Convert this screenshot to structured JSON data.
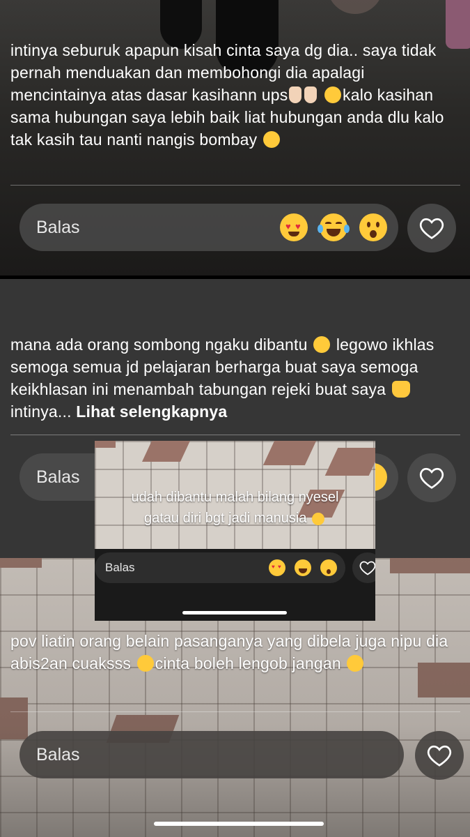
{
  "comments": [
    {
      "text_1": "intinya seburuk apapun kisah cinta saya dg dia.. saya tidak pernah menduakan dan membohongi dia apalagi mencintainya atas dasar kasihann ups",
      "text_2": "kalo kasihan sama hubungan saya lebih baik liat hubungan anda dlu kalo tak kasih tau nanti nangis bombay"
    },
    {
      "text_1": "mana ada orang sombong ngaku dibantu",
      "text_2": "legowo ikhlas semoga semua jd pelajaran berharga buat saya semoga keikhlasan ini menambah tabungan rejeki buat saya",
      "text_3": "intinya...",
      "more_label": "Lihat selengkapnya"
    },
    {
      "text_1": "pov liatin orang belain pasanganya yang dibela juga nipu dia abis2an cuaksss",
      "text_2": "cinta boleh lengob jangan"
    }
  ],
  "reply": {
    "label": "Balas",
    "reactions": [
      "heart-eyes-emoji",
      "tears-of-joy-emoji",
      "surprised-emoji"
    ]
  },
  "overlay": {
    "caption_line1": "udah dibantu malah bilang nyesel",
    "caption_line2": "gatau diri bgt jadi manusia",
    "reply_label": "Balas"
  },
  "colors": {
    "emoji_yellow": "#ffca3a",
    "pill_gray": "#505050",
    "divider": "#ffffff"
  }
}
